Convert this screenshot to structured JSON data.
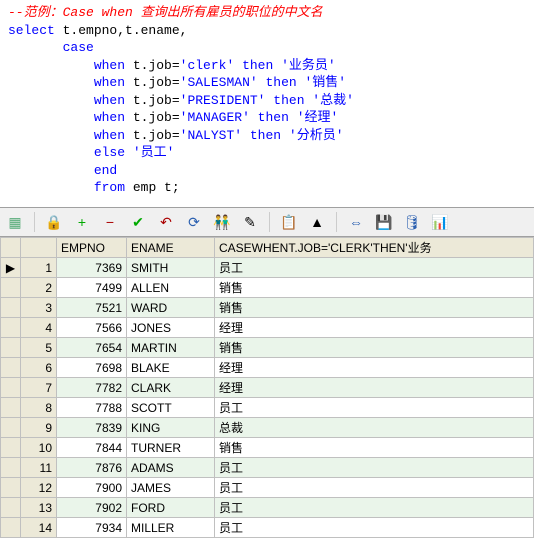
{
  "code": {
    "comment": "--范例：Case when 查询出所有雇员的职位的中文名",
    "line1": {
      "kw": "select",
      "rest": " t.empno,t.ename,"
    },
    "line2": {
      "indent": "       ",
      "kw": "case"
    },
    "wclauses": [
      {
        "indent": "           ",
        "kw1": "when",
        "cond": " t.job=",
        "str": "'clerk'",
        "kw2": " then ",
        "str2": "'业务员'"
      },
      {
        "indent": "           ",
        "kw1": "when",
        "cond": " t.job=",
        "str": "'SALESMAN'",
        "kw2": " then ",
        "str2": "'销售'"
      },
      {
        "indent": "           ",
        "kw1": "when",
        "cond": " t.job=",
        "str": "'PRESIDENT'",
        "kw2": " then ",
        "str2": "'总裁'"
      },
      {
        "indent": "           ",
        "kw1": "when",
        "cond": " t.job=",
        "str": "'MANAGER'",
        "kw2": " then ",
        "str2": "'经理'"
      },
      {
        "indent": "           ",
        "kw1": "when",
        "cond": " t.job=",
        "str": "'NALYST'",
        "kw2": " then ",
        "str2": "'分析员'"
      }
    ],
    "else": {
      "indent": "           ",
      "kw": "else ",
      "str": "'员工'"
    },
    "end": {
      "indent": "           ",
      "kw": "end"
    },
    "from": {
      "indent": "           ",
      "kw": "from",
      "rest": " emp t;"
    }
  },
  "toolbar": {
    "icons": {
      "grid": "▦",
      "lock": "🔒",
      "plus": "+",
      "minus": "−",
      "check": "✔",
      "undo": "↶",
      "refresh": "⟳",
      "find": "👬",
      "copycol": "✎",
      "paste": "📋",
      "filter": "▲",
      "link": "⇔",
      "save": "💾",
      "db": "🛢",
      "chart": "📊"
    }
  },
  "columns": {
    "empno": "EMPNO",
    "ename": "ENAME",
    "casecol": "CASEWHENT.JOB='CLERK'THEN'业务"
  },
  "rows": [
    {
      "mark": "▶",
      "n": "1",
      "empno": "7369",
      "ename": "SMITH",
      "role": "员工"
    },
    {
      "mark": "",
      "n": "2",
      "empno": "7499",
      "ename": "ALLEN",
      "role": "销售"
    },
    {
      "mark": "",
      "n": "3",
      "empno": "7521",
      "ename": "WARD",
      "role": "销售"
    },
    {
      "mark": "",
      "n": "4",
      "empno": "7566",
      "ename": "JONES",
      "role": "经理"
    },
    {
      "mark": "",
      "n": "5",
      "empno": "7654",
      "ename": "MARTIN",
      "role": "销售"
    },
    {
      "mark": "",
      "n": "6",
      "empno": "7698",
      "ename": "BLAKE",
      "role": "经理"
    },
    {
      "mark": "",
      "n": "7",
      "empno": "7782",
      "ename": "CLARK",
      "role": "经理"
    },
    {
      "mark": "",
      "n": "8",
      "empno": "7788",
      "ename": "SCOTT",
      "role": "员工"
    },
    {
      "mark": "",
      "n": "9",
      "empno": "7839",
      "ename": "KING",
      "role": "总裁"
    },
    {
      "mark": "",
      "n": "10",
      "empno": "7844",
      "ename": "TURNER",
      "role": "销售"
    },
    {
      "mark": "",
      "n": "11",
      "empno": "7876",
      "ename": "ADAMS",
      "role": "员工"
    },
    {
      "mark": "",
      "n": "12",
      "empno": "7900",
      "ename": "JAMES",
      "role": "员工"
    },
    {
      "mark": "",
      "n": "13",
      "empno": "7902",
      "ename": "FORD",
      "role": "员工"
    },
    {
      "mark": "",
      "n": "14",
      "empno": "7934",
      "ename": "MILLER",
      "role": "员工"
    }
  ]
}
